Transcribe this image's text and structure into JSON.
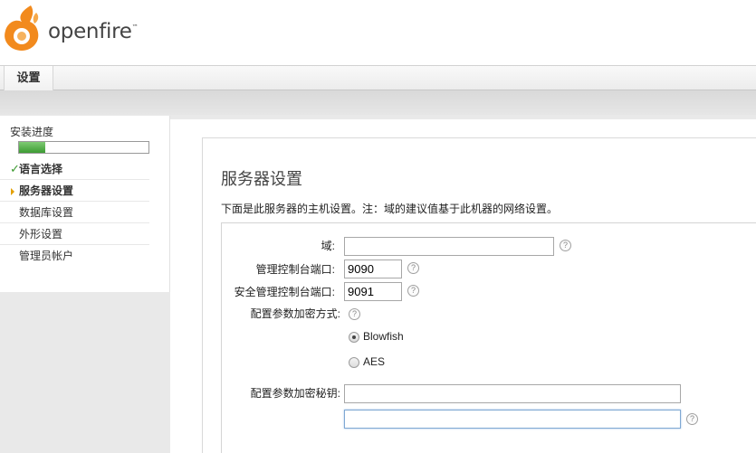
{
  "brand": {
    "name": "openfire",
    "tm": "™"
  },
  "tabs": [
    {
      "label": "设置"
    }
  ],
  "sidebar": {
    "progress_title": "安装进度",
    "progress_value": 0.2,
    "items": [
      {
        "label": "语言选择",
        "state": "done"
      },
      {
        "label": "服务器设置",
        "state": "current"
      },
      {
        "label": "数据库设置",
        "state": "pending"
      },
      {
        "label": "外形设置",
        "state": "pending"
      },
      {
        "label": "管理员帐户",
        "state": "pending"
      }
    ]
  },
  "main": {
    "title": "服务器设置",
    "description": "下面是此服务器的主机设置。注：域的建议值基于此机器的网络设置。",
    "fields": {
      "domain": {
        "label": "域:",
        "value": ""
      },
      "admin_port": {
        "label": "管理控制台端口:",
        "value": "9090"
      },
      "secure_admin_port": {
        "label": "安全管理控制台端口:",
        "value": "9091"
      },
      "encryption": {
        "label": "配置参数加密方式:",
        "options": [
          {
            "label": "Blowfish",
            "selected": true
          },
          {
            "label": "AES",
            "selected": false
          }
        ]
      },
      "encryption_key": {
        "label": "配置参数加密秘钥:",
        "value": "",
        "confirm_value": ""
      }
    },
    "help_glyph": "?"
  }
}
